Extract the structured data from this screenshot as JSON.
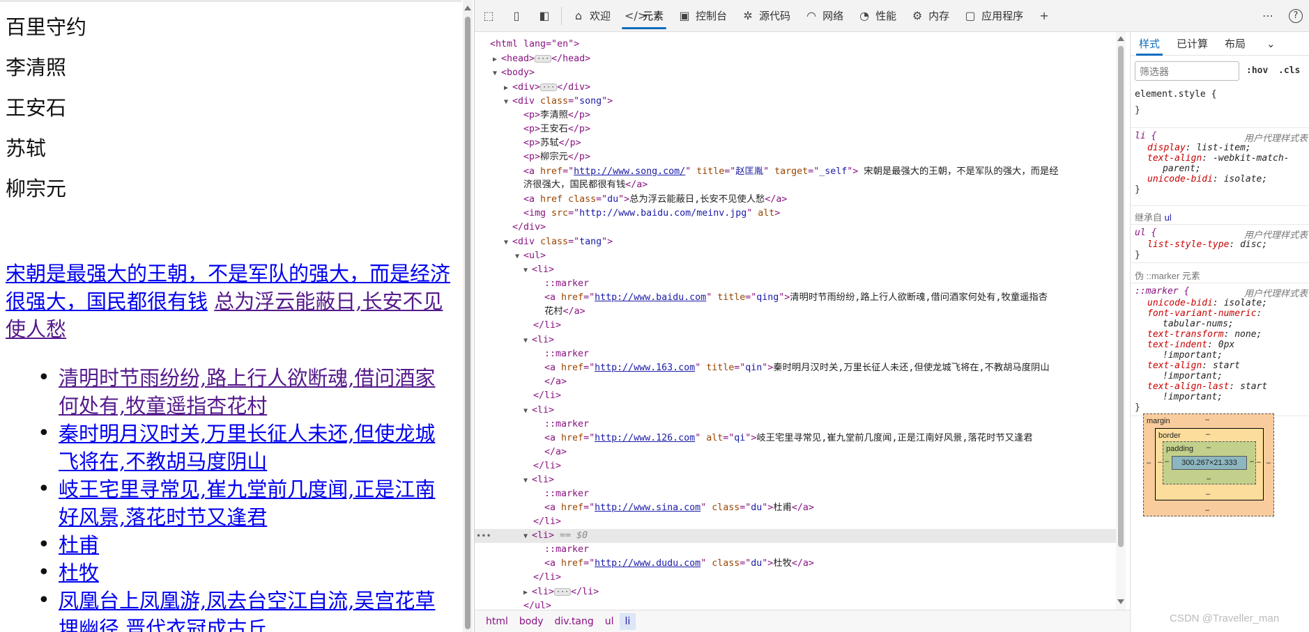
{
  "page": {
    "paras": [
      "百里守约",
      "李清照",
      "王安石",
      "苏轼",
      "柳宗元"
    ],
    "song_link": "宋朝是最强大的王朝，不是军队的强大，而是经济很强大，国民都很有钱",
    "du_link": "总为浮云能蔽日,长安不见使人愁",
    "tang_items": [
      "清明时节雨纷纷,路上行人欲断魂,借问酒家何处有,牧童遥指杏花村",
      "秦时明月汉时关,万里长征人未还,但使龙城飞将在,不教胡马度阴山",
      "岐王宅里寻常见,崔九堂前几度闻,正是江南好风景,落花时节又逢君",
      "杜甫",
      "杜牧",
      "凤凰台上凤凰游,凤去台空江自流,吴宫花草埋幽径,晋代衣冠成古丘"
    ]
  },
  "toolbar": {
    "tabs": [
      "欢迎",
      "元素",
      "控制台",
      "源代码",
      "网络",
      "性能",
      "内存",
      "应用程序"
    ],
    "more": "⋯",
    "help": "?"
  },
  "elements": {
    "html_open": "<html lang=\"en\">",
    "head": "head",
    "body": "body",
    "div": "div",
    "song_cls": "song",
    "song_ps": [
      "李清照",
      "王安石",
      "苏轼",
      "柳宗元"
    ],
    "a1_href": "http://www.song.com/",
    "a1_title": "赵匡胤",
    "a1_target": "_self",
    "a1_text_1": " 宋朝是最强大的王朝，不是军队的强大，而是经",
    "a1_text_2": "济很强大，国民都很有钱",
    "a2_class": "du",
    "a2_text": "总为浮云能蔽日,长安不见使人愁",
    "img_src": "http://www.baidu.com/meinv.jpg",
    "tang_cls": "tang",
    "marker": "::marker",
    "li1_href": "http://www.baidu.com",
    "li1_title": "qing",
    "li1_text_1": "清明时节雨纷纷,路上行人欲断魂,借问酒家何处有,牧童遥指杏",
    "li1_text_2": "花村",
    "li2_href": "http://www.163.com",
    "li2_title": "qin",
    "li2_text": "秦时明月汉时关,万里长征人未还,但使龙城飞将在,不教胡马度阴山",
    "li3_href": "http://www.126.com",
    "li3_alt": "qi",
    "li3_text": "岐王宅里寻常见,崔九堂前几度闻,正是江南好风景,落花时节又逢君",
    "li4_href": "http://www.sina.com",
    "li4_class": "du",
    "li4_text": "杜甫",
    "li5_href": "http://www.dudu.com",
    "li5_class": "du",
    "li5_text": "杜牧",
    "selected_marker": "== $0"
  },
  "breadcrumb": [
    "html",
    "body",
    "div.tang",
    "ul",
    "li"
  ],
  "styles": {
    "tabs": [
      "样式",
      "已计算",
      "布局"
    ],
    "filter_placeholder": "筛选器",
    "hov": ":hov",
    "cls": ".cls",
    "element_style": "element.style {",
    "close": "}",
    "ua_origin": "用户代理样式表",
    "li_sel": "li {",
    "li_props": [
      [
        "display",
        "list-item;"
      ],
      [
        "text-align",
        "-webkit-match-"
      ],
      [
        "",
        "parent;"
      ],
      [
        "unicode-bidi",
        "isolate;"
      ]
    ],
    "inherited_label": "继承自",
    "inherited_tag": "ul",
    "ul_sel": "ul {",
    "ul_props": [
      [
        "list-style-type",
        "disc;"
      ]
    ],
    "pseudo_label": "伪 ::marker 元素",
    "marker_sel": "::marker {",
    "marker_props": [
      [
        "unicode-bidi",
        "isolate;"
      ],
      [
        "font-variant-numeric",
        ""
      ],
      [
        "",
        "tabular-nums;"
      ],
      [
        "text-transform",
        "none;"
      ],
      [
        "text-indent",
        "0px"
      ],
      [
        "",
        "!important;"
      ],
      [
        "text-align",
        "start"
      ],
      [
        "",
        "!important;"
      ],
      [
        "text-align-last",
        "start"
      ],
      [
        "",
        "!important;"
      ]
    ],
    "box": {
      "margin": "margin",
      "border": "border",
      "padding": "padding",
      "dash": "–",
      "content": "300.267×21.333"
    }
  },
  "watermark": "CSDN @Traveller_man"
}
